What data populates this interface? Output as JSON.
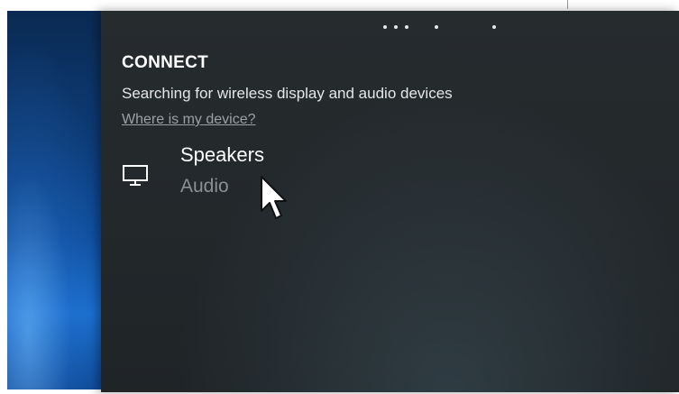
{
  "connect_panel": {
    "title": "CONNECT",
    "status_text": "Searching for wireless display and audio devices",
    "help_link": "Where is my device?",
    "devices": [
      {
        "name": "Speakers",
        "type": "Audio",
        "icon": "monitor-icon"
      }
    ]
  },
  "progress_indicator": {
    "icon": "searching-dots-icon"
  },
  "colors": {
    "panel_background": "#23282b",
    "title_text": "#ffffff",
    "secondary_text": "#8a9094",
    "link_text": "#9aa1a6"
  }
}
